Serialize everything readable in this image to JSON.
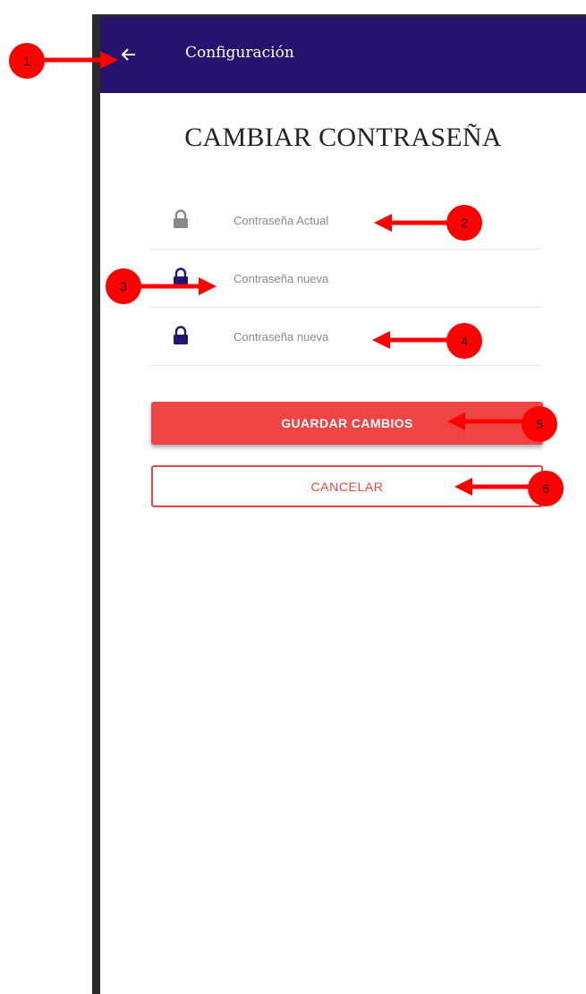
{
  "appbar": {
    "title": "Configuración",
    "back_icon": "arrow-left-icon",
    "background": "#26136e"
  },
  "page": {
    "title": "CAMBIAR CONTRASEÑA"
  },
  "fields": [
    {
      "placeholder": "Contraseña Actual",
      "icon": "lock-icon",
      "icon_color": "#888888"
    },
    {
      "placeholder": "Contraseña nueva",
      "icon": "lock-icon",
      "icon_color": "#26136e"
    },
    {
      "placeholder": "Contraseña nueva",
      "icon": "lock-icon",
      "icon_color": "#26136e"
    }
  ],
  "buttons": {
    "save_label": "GUARDAR CAMBIOS",
    "cancel_label": "CANCELAR",
    "accent": "#ef4444"
  },
  "annotations": [
    "1",
    "2",
    "3",
    "4",
    "5",
    "6"
  ]
}
